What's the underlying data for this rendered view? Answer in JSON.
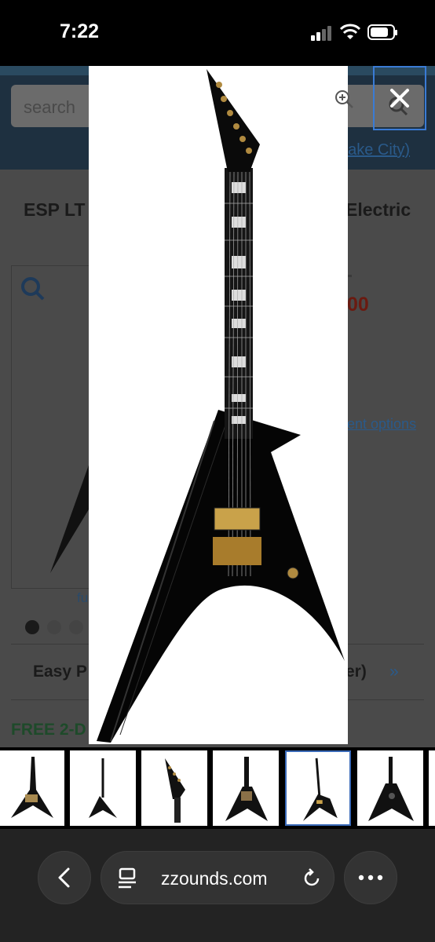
{
  "status_bar": {
    "time": "7:22",
    "signal_icon": "cellular-signal-icon",
    "wifi_icon": "wifi-icon",
    "battery_icon": "battery-icon"
  },
  "page": {
    "search_placeholder": "search",
    "location_text": "Lake City)",
    "title_left": "ESP LT",
    "title_right": "Electric",
    "price": "00",
    "payment_text": "ent options",
    "fu_text": "fu",
    "easy_left": "Easy P",
    "easy_right": "er)",
    "easy_chevron": "»",
    "free_text": "FREE 2-D",
    "dots_count": 3
  },
  "modal": {
    "zoom_icon": "zoom-in-icon",
    "close_icon": "close-icon",
    "image_subject": "black V-shaped electric guitar"
  },
  "thumbnails": {
    "selected_index": 4
  },
  "toolbar": {
    "url": "zzounds.com",
    "back_icon": "chevron-left-icon",
    "page_icon": "page-settings-icon",
    "reload_icon": "reload-icon",
    "more_icon": "more-icon"
  },
  "colors": {
    "close_border": "#3a7bd5",
    "selected_thumb_border": "#3a6ab8",
    "price_color": "#6a1a10"
  }
}
